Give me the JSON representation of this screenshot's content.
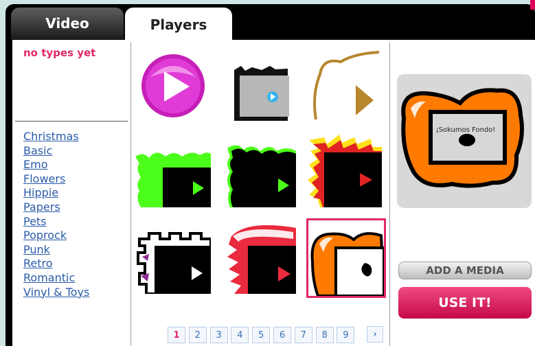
{
  "tabs": [
    {
      "label": "Video",
      "active": false
    },
    {
      "label": "Players",
      "active": true
    }
  ],
  "types_message": "no types yet",
  "categories": [
    "Christmas",
    "Basic",
    "Emo",
    "Flowers",
    "Hippie",
    "Papers",
    "Pets",
    "Poprock",
    "Punk",
    "Retro",
    "Romantic",
    "Vinyl & Toys"
  ],
  "thumbnails": [
    {
      "icon": "magenta-play-orb-icon",
      "selected": false
    },
    {
      "icon": "grey-screen-player-icon",
      "selected": false
    },
    {
      "icon": "gold-frame-arrow-icon",
      "selected": false
    },
    {
      "icon": "green-splat-player-icon",
      "selected": false
    },
    {
      "icon": "black-splat-player-icon",
      "selected": false
    },
    {
      "icon": "yellow-spike-player-icon",
      "selected": false
    },
    {
      "icon": "castle-player-icon",
      "selected": false
    },
    {
      "icon": "red-jaw-player-icon",
      "selected": false
    },
    {
      "icon": "orange-blob-player-icon",
      "selected": true
    }
  ],
  "preview": {
    "screen_text": "¡Sokumos Fondo!"
  },
  "buttons": {
    "add_media": "ADD A MEDIA",
    "use_it": "USE IT!"
  },
  "pagination": {
    "pages": [
      "1",
      "2",
      "3",
      "4",
      "5",
      "6",
      "7",
      "8",
      "9"
    ],
    "current": "1",
    "next_glyph": "›"
  },
  "colors": {
    "accent": "#e0286a",
    "link": "#2a5ba8",
    "tab_bar": "#000000",
    "use_button": "#d8115a"
  }
}
